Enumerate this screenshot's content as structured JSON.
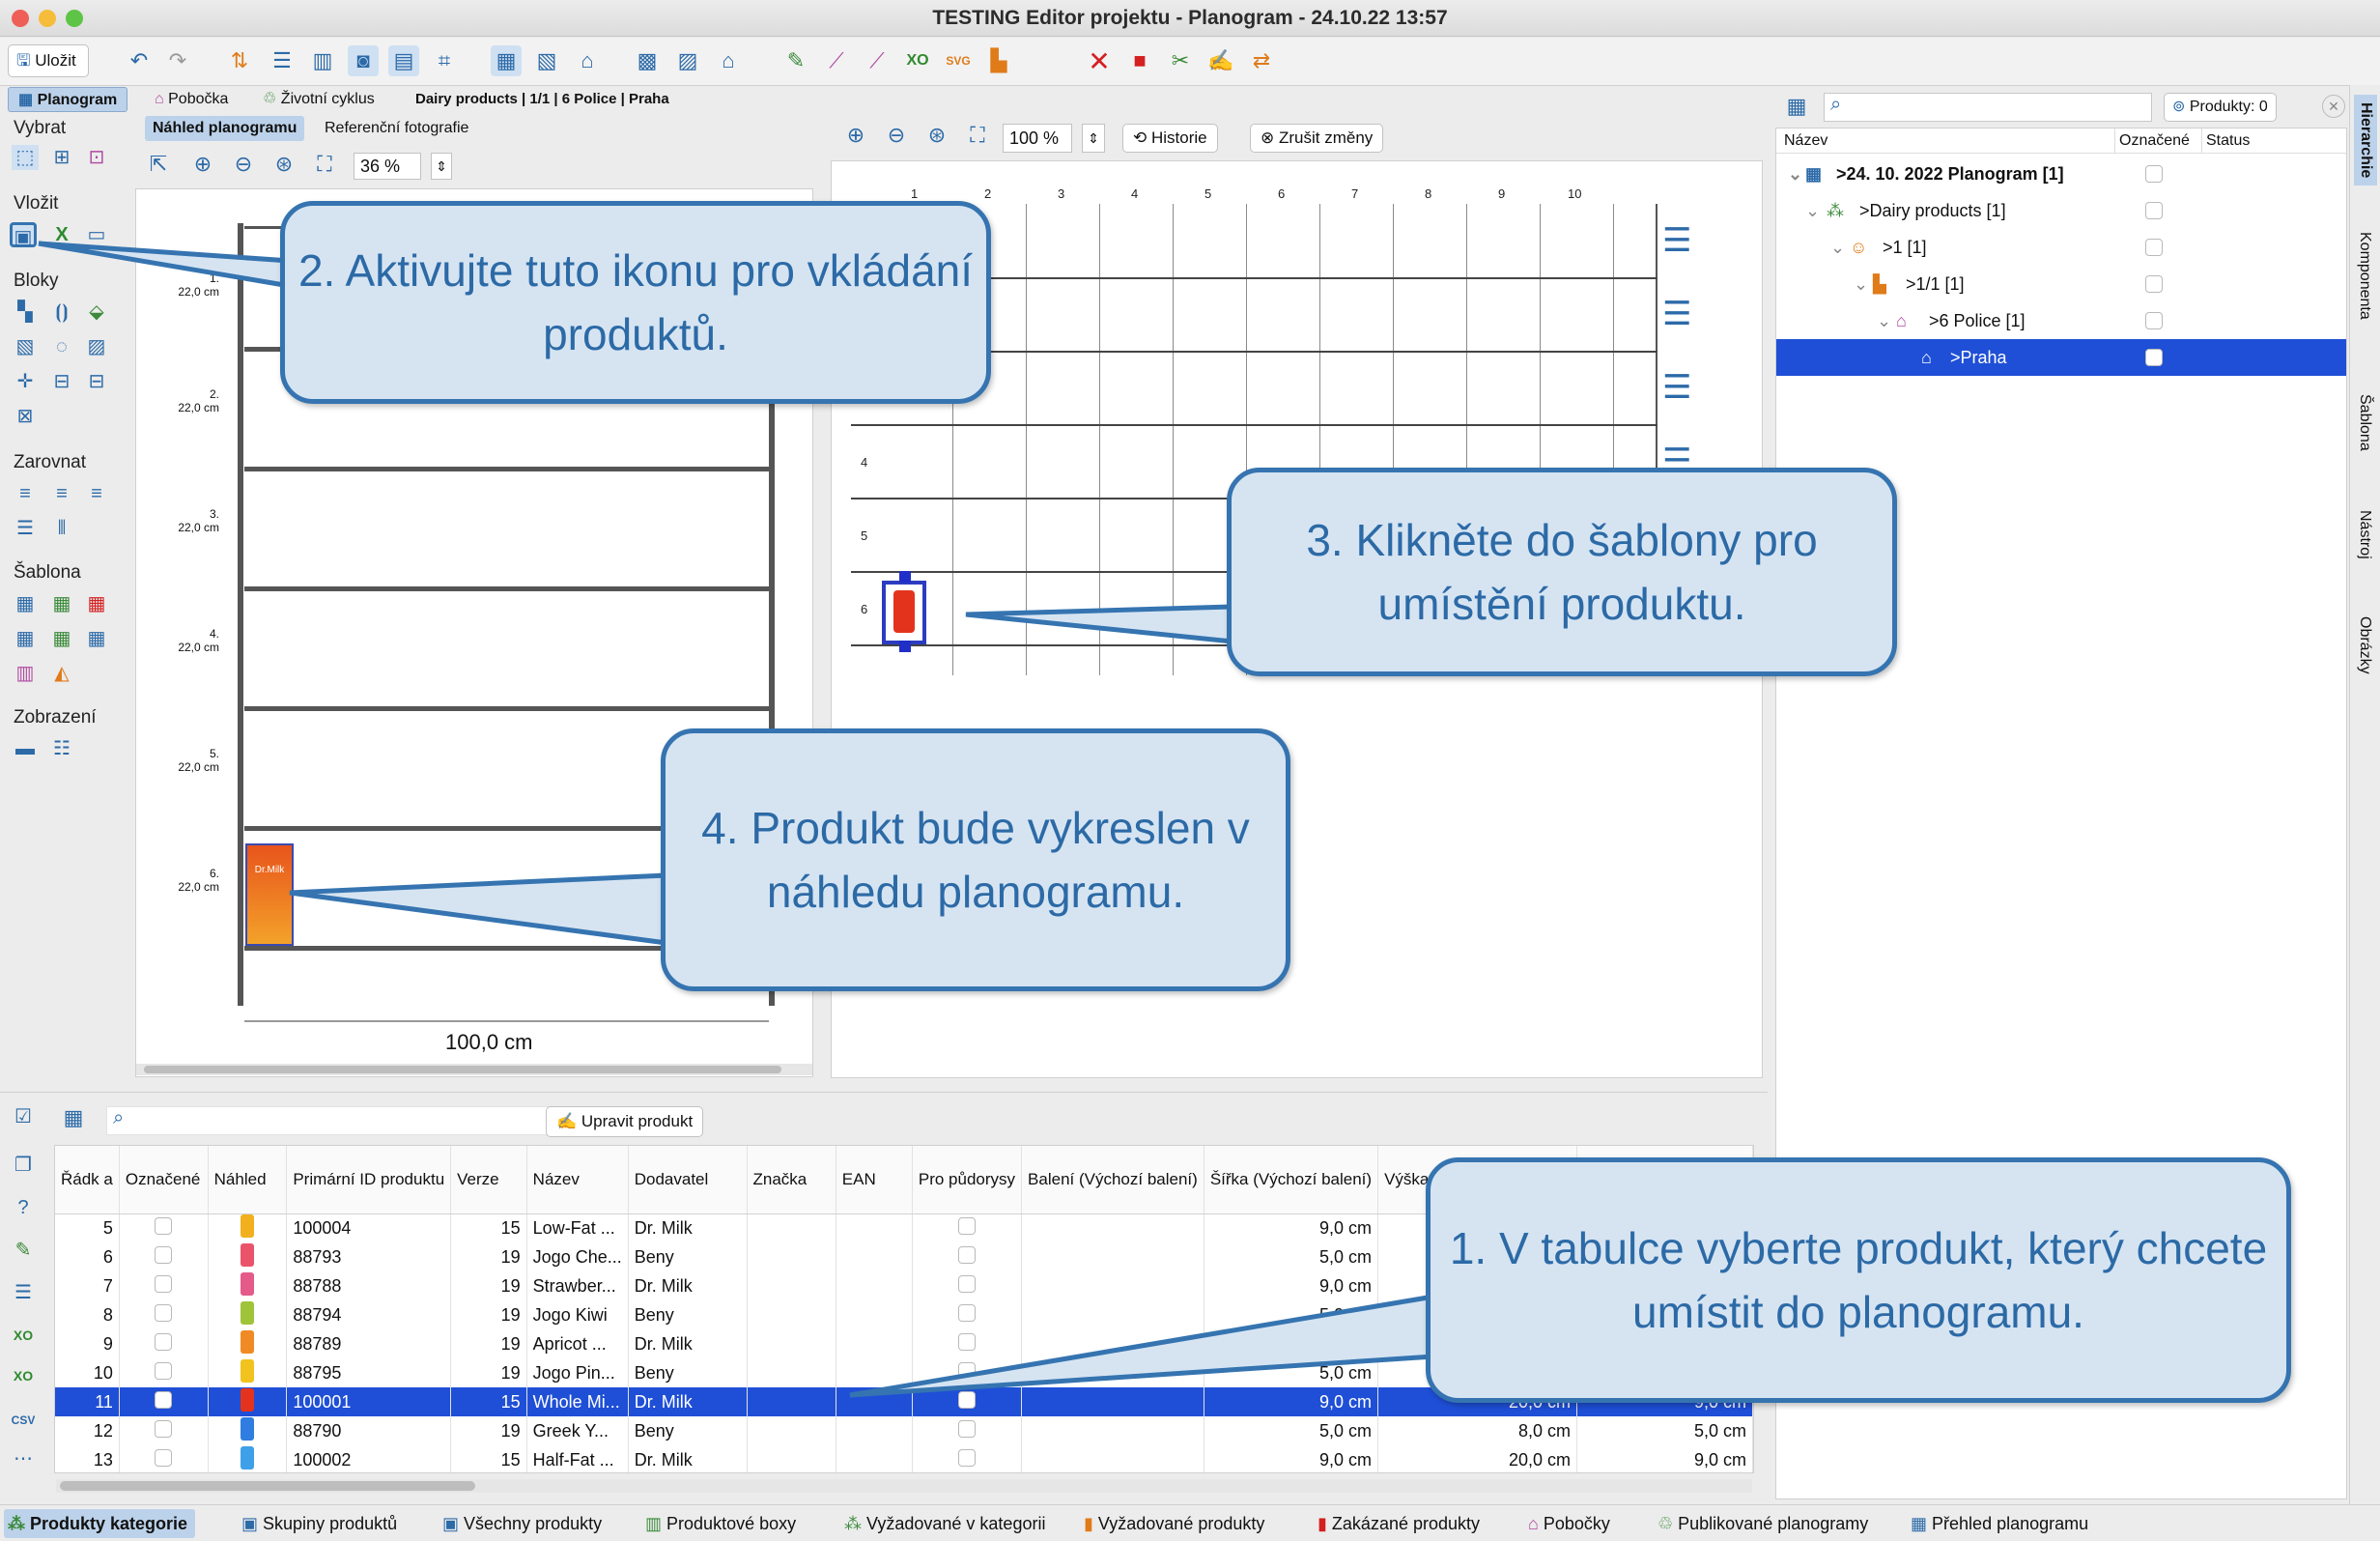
{
  "window": {
    "title": "TESTING Editor projektu - Planogram - 24.10.22 13:57"
  },
  "toolbar": {
    "save_label": "Uložit"
  },
  "context": {
    "tab_planogram": "Planogram",
    "tab_branch": "Pobočka",
    "tab_lifecycle": "Životní cyklus",
    "breadcrumb": "Dairy products | 1/1 | 6 Police | Praha"
  },
  "left_panel": {
    "select": "Vybrat",
    "insert": "Vložit",
    "blocks": "Bloky",
    "align": "Zarovnat",
    "template": "Šablona",
    "display": "Zobrazení"
  },
  "preview": {
    "tab_preview": "Náhled planogramu",
    "tab_ref": "Referenční fotografie",
    "zoom": "36 %",
    "width_label": "100,0 cm",
    "shelves": [
      {
        "n": "1.",
        "h": "22,0 cm"
      },
      {
        "n": "2.",
        "h": "22,0 cm"
      },
      {
        "n": "3.",
        "h": "22,0 cm"
      },
      {
        "n": "4.",
        "h": "22,0 cm"
      },
      {
        "n": "5.",
        "h": "22,0 cm"
      },
      {
        "n": "6.",
        "h": "22,0 cm"
      }
    ],
    "product_text": "Dr.Milk"
  },
  "template_editor": {
    "zoom": "100 %",
    "history": "Historie",
    "cancel_changes": "Zrušit změny",
    "columns": [
      "1",
      "2",
      "3",
      "4",
      "5",
      "6",
      "7",
      "8",
      "9",
      "10"
    ],
    "rows": [
      "4",
      "5",
      "6"
    ]
  },
  "tree": {
    "products_label": "Produkty: 0",
    "col_name": "Název",
    "col_marked": "Označené",
    "col_status": "Status",
    "items": [
      ">24. 10. 2022 Planogram [1]",
      ">Dairy products [1]",
      ">1 [1]",
      ">1/1 [1]",
      ">6 Police [1]",
      ">Praha"
    ]
  },
  "right_vtabs": [
    "Hierarchie",
    "Komponenta",
    "Šablona",
    "Nástroj",
    "Obrázky"
  ],
  "products": {
    "edit_button": "Upravit produkt",
    "headers": [
      "Řádk a",
      "Označené",
      "Náhled",
      "Primární ID produktu",
      "Verze",
      "Název",
      "Dodavatel",
      "Značka",
      "EAN",
      "Pro půdorysy",
      "Balení (Výchozí balení)",
      "Šířka (Výchozí balení)",
      "Výška (Výcho",
      "",
      ""
    ],
    "rows": [
      [
        "5",
        "100004",
        "15",
        "Low-Fat ...",
        "Dr. Milk",
        "9,0 cm",
        "",
        "",
        false
      ],
      [
        "6",
        "88793",
        "19",
        "Jogo Che...",
        "Beny",
        "5,0 cm",
        "",
        "",
        false
      ],
      [
        "7",
        "88788",
        "19",
        "Strawber...",
        "Dr. Milk",
        "9,0 cm",
        "",
        "",
        false
      ],
      [
        "8",
        "88794",
        "19",
        "Jogo Kiwi",
        "Beny",
        "5,0 cm",
        "",
        "",
        false
      ],
      [
        "9",
        "88789",
        "19",
        "Apricot ...",
        "Dr. Milk",
        "9,0 cm",
        "",
        "",
        false
      ],
      [
        "10",
        "88795",
        "19",
        "Jogo Pin...",
        "Beny",
        "5,0 cm",
        "",
        "",
        false
      ],
      [
        "11",
        "100001",
        "15",
        "Whole Mi...",
        "Dr. Milk",
        "9,0 cm",
        "20,0 cm",
        "9,0 cm",
        true
      ],
      [
        "12",
        "88790",
        "19",
        "Greek Y...",
        "Beny",
        "5,0 cm",
        "8,0 cm",
        "5,0 cm",
        false
      ],
      [
        "13",
        "100002",
        "15",
        "Half-Fat ...",
        "Dr. Milk",
        "9,0 cm",
        "20,0 cm",
        "9,0 cm",
        false
      ]
    ]
  },
  "bottom_tabs": [
    "Produkty kategorie",
    "Skupiny produktů",
    "Všechny produkty",
    "Produktové boxy",
    "Vyžadované v kategorii",
    "Vyžadované produkty",
    "Zakázané produkty",
    "Pobočky",
    "Publikované planogramy",
    "Přehled planogramu"
  ],
  "callouts": {
    "c1": "1. V tabulce vyberte produkt, který chcete umístit do planogramu.",
    "c2": "2. Aktivujte tuto ikonu pro vkládání produktů.",
    "c3": "3. Klikněte do šablony pro umístění produktu.",
    "c4": "4. Produkt bude vykreslen v náhledu planogramu."
  },
  "colors": {
    "accent": "#3574b0",
    "callout_bg": "#d6e4f2",
    "selection": "#1f4fd6"
  }
}
